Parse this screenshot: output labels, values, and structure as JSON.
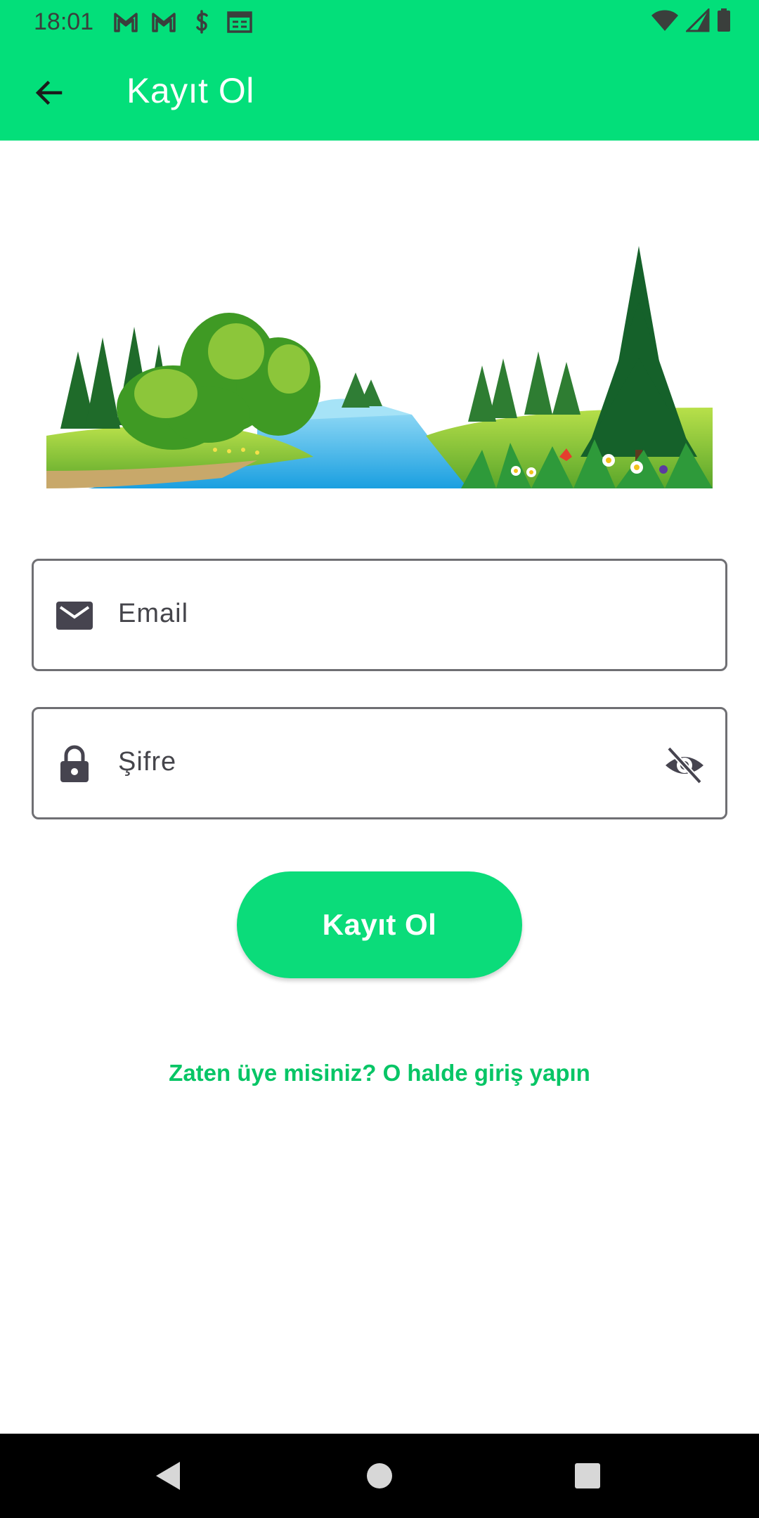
{
  "status_bar": {
    "time": "18:01",
    "notification_icons": [
      "gmail-icon",
      "gmail-icon",
      "sync-icon",
      "calendar-icon"
    ],
    "right_icons": [
      "wifi-icon",
      "signal-icon",
      "battery-icon"
    ]
  },
  "app_bar": {
    "title": "Kayıt Ol",
    "back_icon": "arrow-back-icon",
    "background": "#03df7a"
  },
  "hero": {
    "image": "landscape-illustration"
  },
  "form": {
    "email": {
      "placeholder": "Email",
      "icon": "mail-icon"
    },
    "password": {
      "placeholder": "Şifre",
      "icon": "lock-icon",
      "toggle_icon": "visibility-off-icon"
    },
    "submit_label": "Kayıt Ol",
    "login_link": "Zaten üye misiniz? O halde giriş yapın"
  },
  "colors": {
    "accent": "#0bdc7a",
    "link": "#08c566"
  },
  "nav_bar": {
    "buttons": [
      "back-triangle-icon",
      "home-circle-icon",
      "recents-square-icon"
    ]
  }
}
